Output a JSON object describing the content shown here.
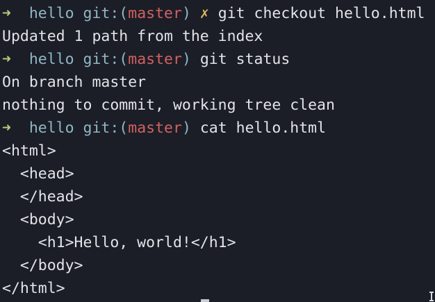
{
  "prompt": {
    "arrow": "➜",
    "dir": "hello",
    "git_prefix": "git:(",
    "branch": "master",
    "git_suffix": ")",
    "dirty_mark": "✗"
  },
  "commands": {
    "checkout": "git checkout hello.html",
    "status": "git status",
    "cat": "cat hello.html"
  },
  "output": {
    "checkout_result": "Updated 1 path from the index",
    "status_branch": "On branch master",
    "status_clean": "nothing to commit, working tree clean",
    "file_lines": [
      "<html>",
      "  <head>",
      "  </head>",
      "  <body>",
      "    <h1>Hello, world!</h1>",
      "  </body>",
      "</html>"
    ]
  }
}
